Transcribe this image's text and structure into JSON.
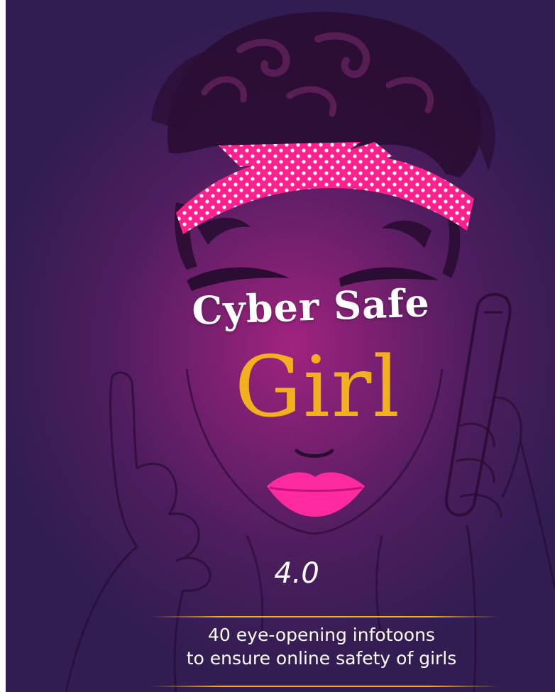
{
  "cover": {
    "title_line1": "Cyber Safe",
    "title_line2": "Girl",
    "version": "4.0",
    "tagline_line1": "40 eye-opening infotoons",
    "tagline_line2": "to ensure online safety of girls"
  },
  "colors": {
    "background_center": "#a1237f",
    "background_edge": "#311d52",
    "accent_gold": "#f2b01e",
    "headband_pink": "#ff1f8e",
    "lips_pink": "#ff2aa0",
    "line_art": "#2a0c33"
  },
  "icons": [
    "woman-illustration",
    "polka-dot-headband",
    "smartphone-icon",
    "raised-finger-hand"
  ]
}
